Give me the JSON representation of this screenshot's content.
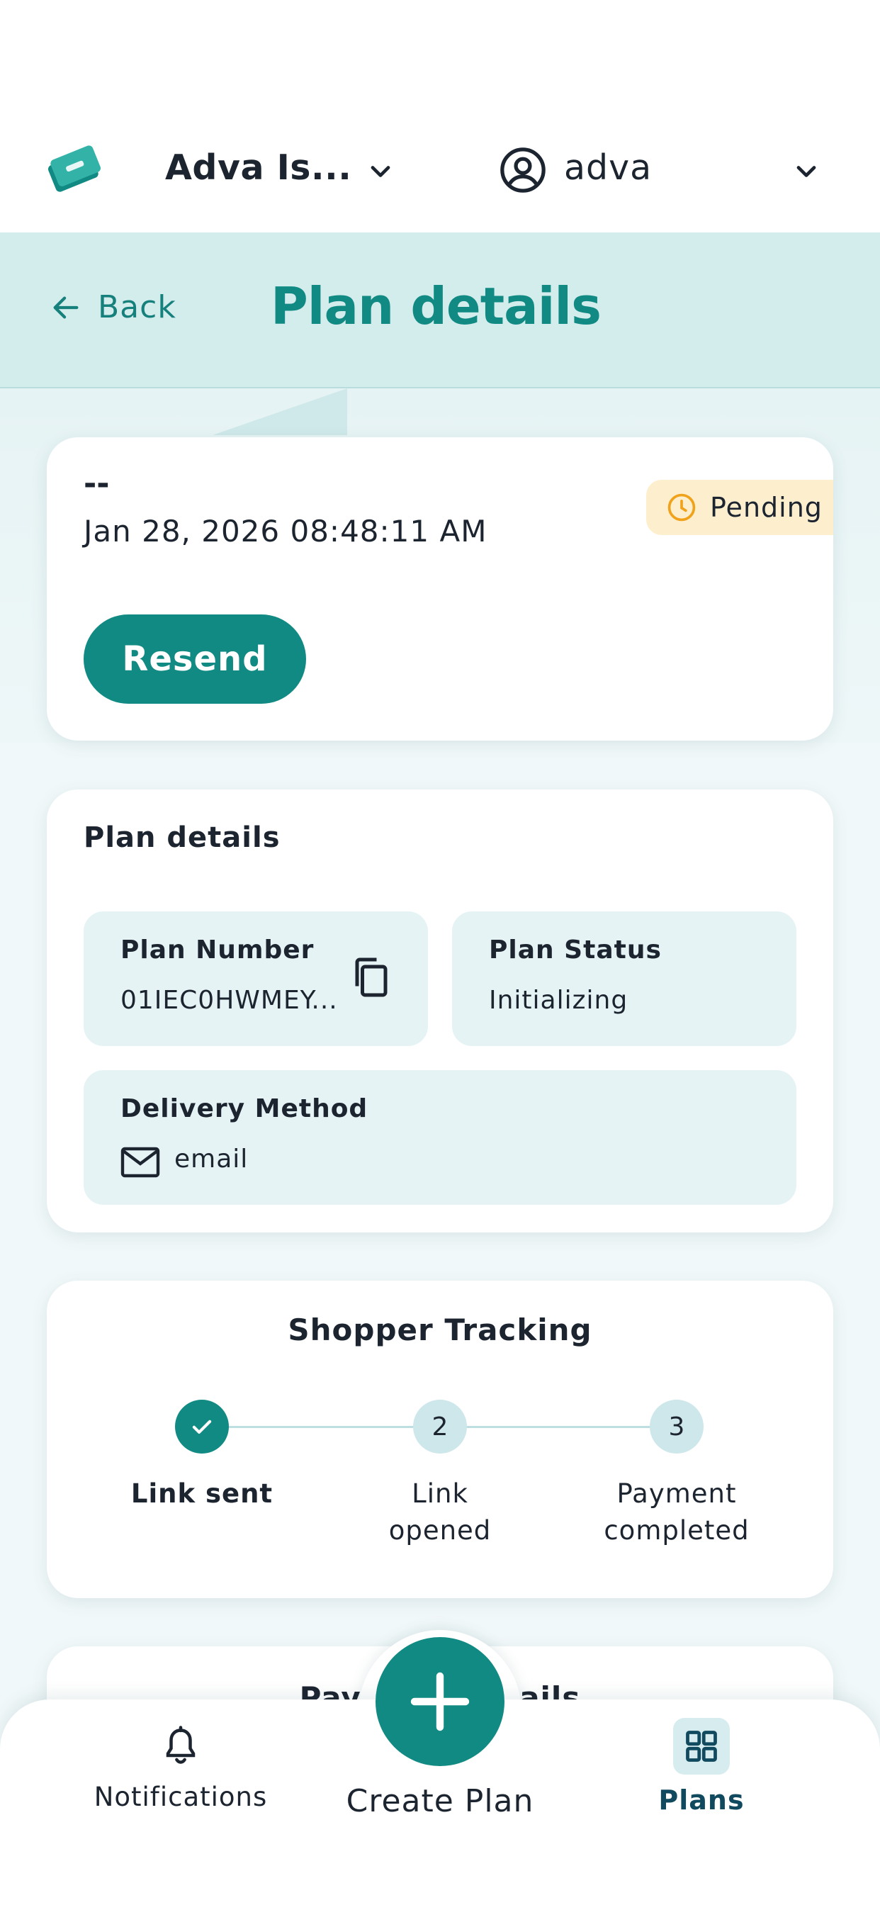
{
  "topbar": {
    "org_name": "Adva Is...",
    "user_name": "adva"
  },
  "header": {
    "back_label": "Back",
    "title": "Plan details"
  },
  "summary": {
    "name": "--",
    "date": "Jan 28, 2026 08:48:11 AM",
    "status": "Pending",
    "resend_label": "Resend"
  },
  "plan_details": {
    "section_title": "Plan details",
    "plan_number_label": "Plan Number",
    "plan_number_value": "01IEC0HWMEY...",
    "plan_status_label": "Plan Status",
    "plan_status_value": "Initializing",
    "delivery_label": "Delivery Method",
    "delivery_value": "email"
  },
  "tracking": {
    "title": "Shopper Tracking",
    "steps": [
      {
        "number": "",
        "line1": "Link sent",
        "line2": "",
        "done": true
      },
      {
        "number": "2",
        "line1": "Link",
        "line2": "opened",
        "done": false
      },
      {
        "number": "3",
        "line1": "Payment",
        "line2": "completed",
        "done": false
      }
    ]
  },
  "payment": {
    "title": "Payment details"
  },
  "nav": {
    "notifications_label": "Notifications",
    "create_label": "Create Plan",
    "plans_label": "Plans"
  },
  "colors": {
    "brand": "#128a84",
    "header_bg": "#d3ecec",
    "pending_bg": "#fdeecd",
    "pending_icon": "#f0a21b",
    "plans_active": "#114a5e"
  }
}
